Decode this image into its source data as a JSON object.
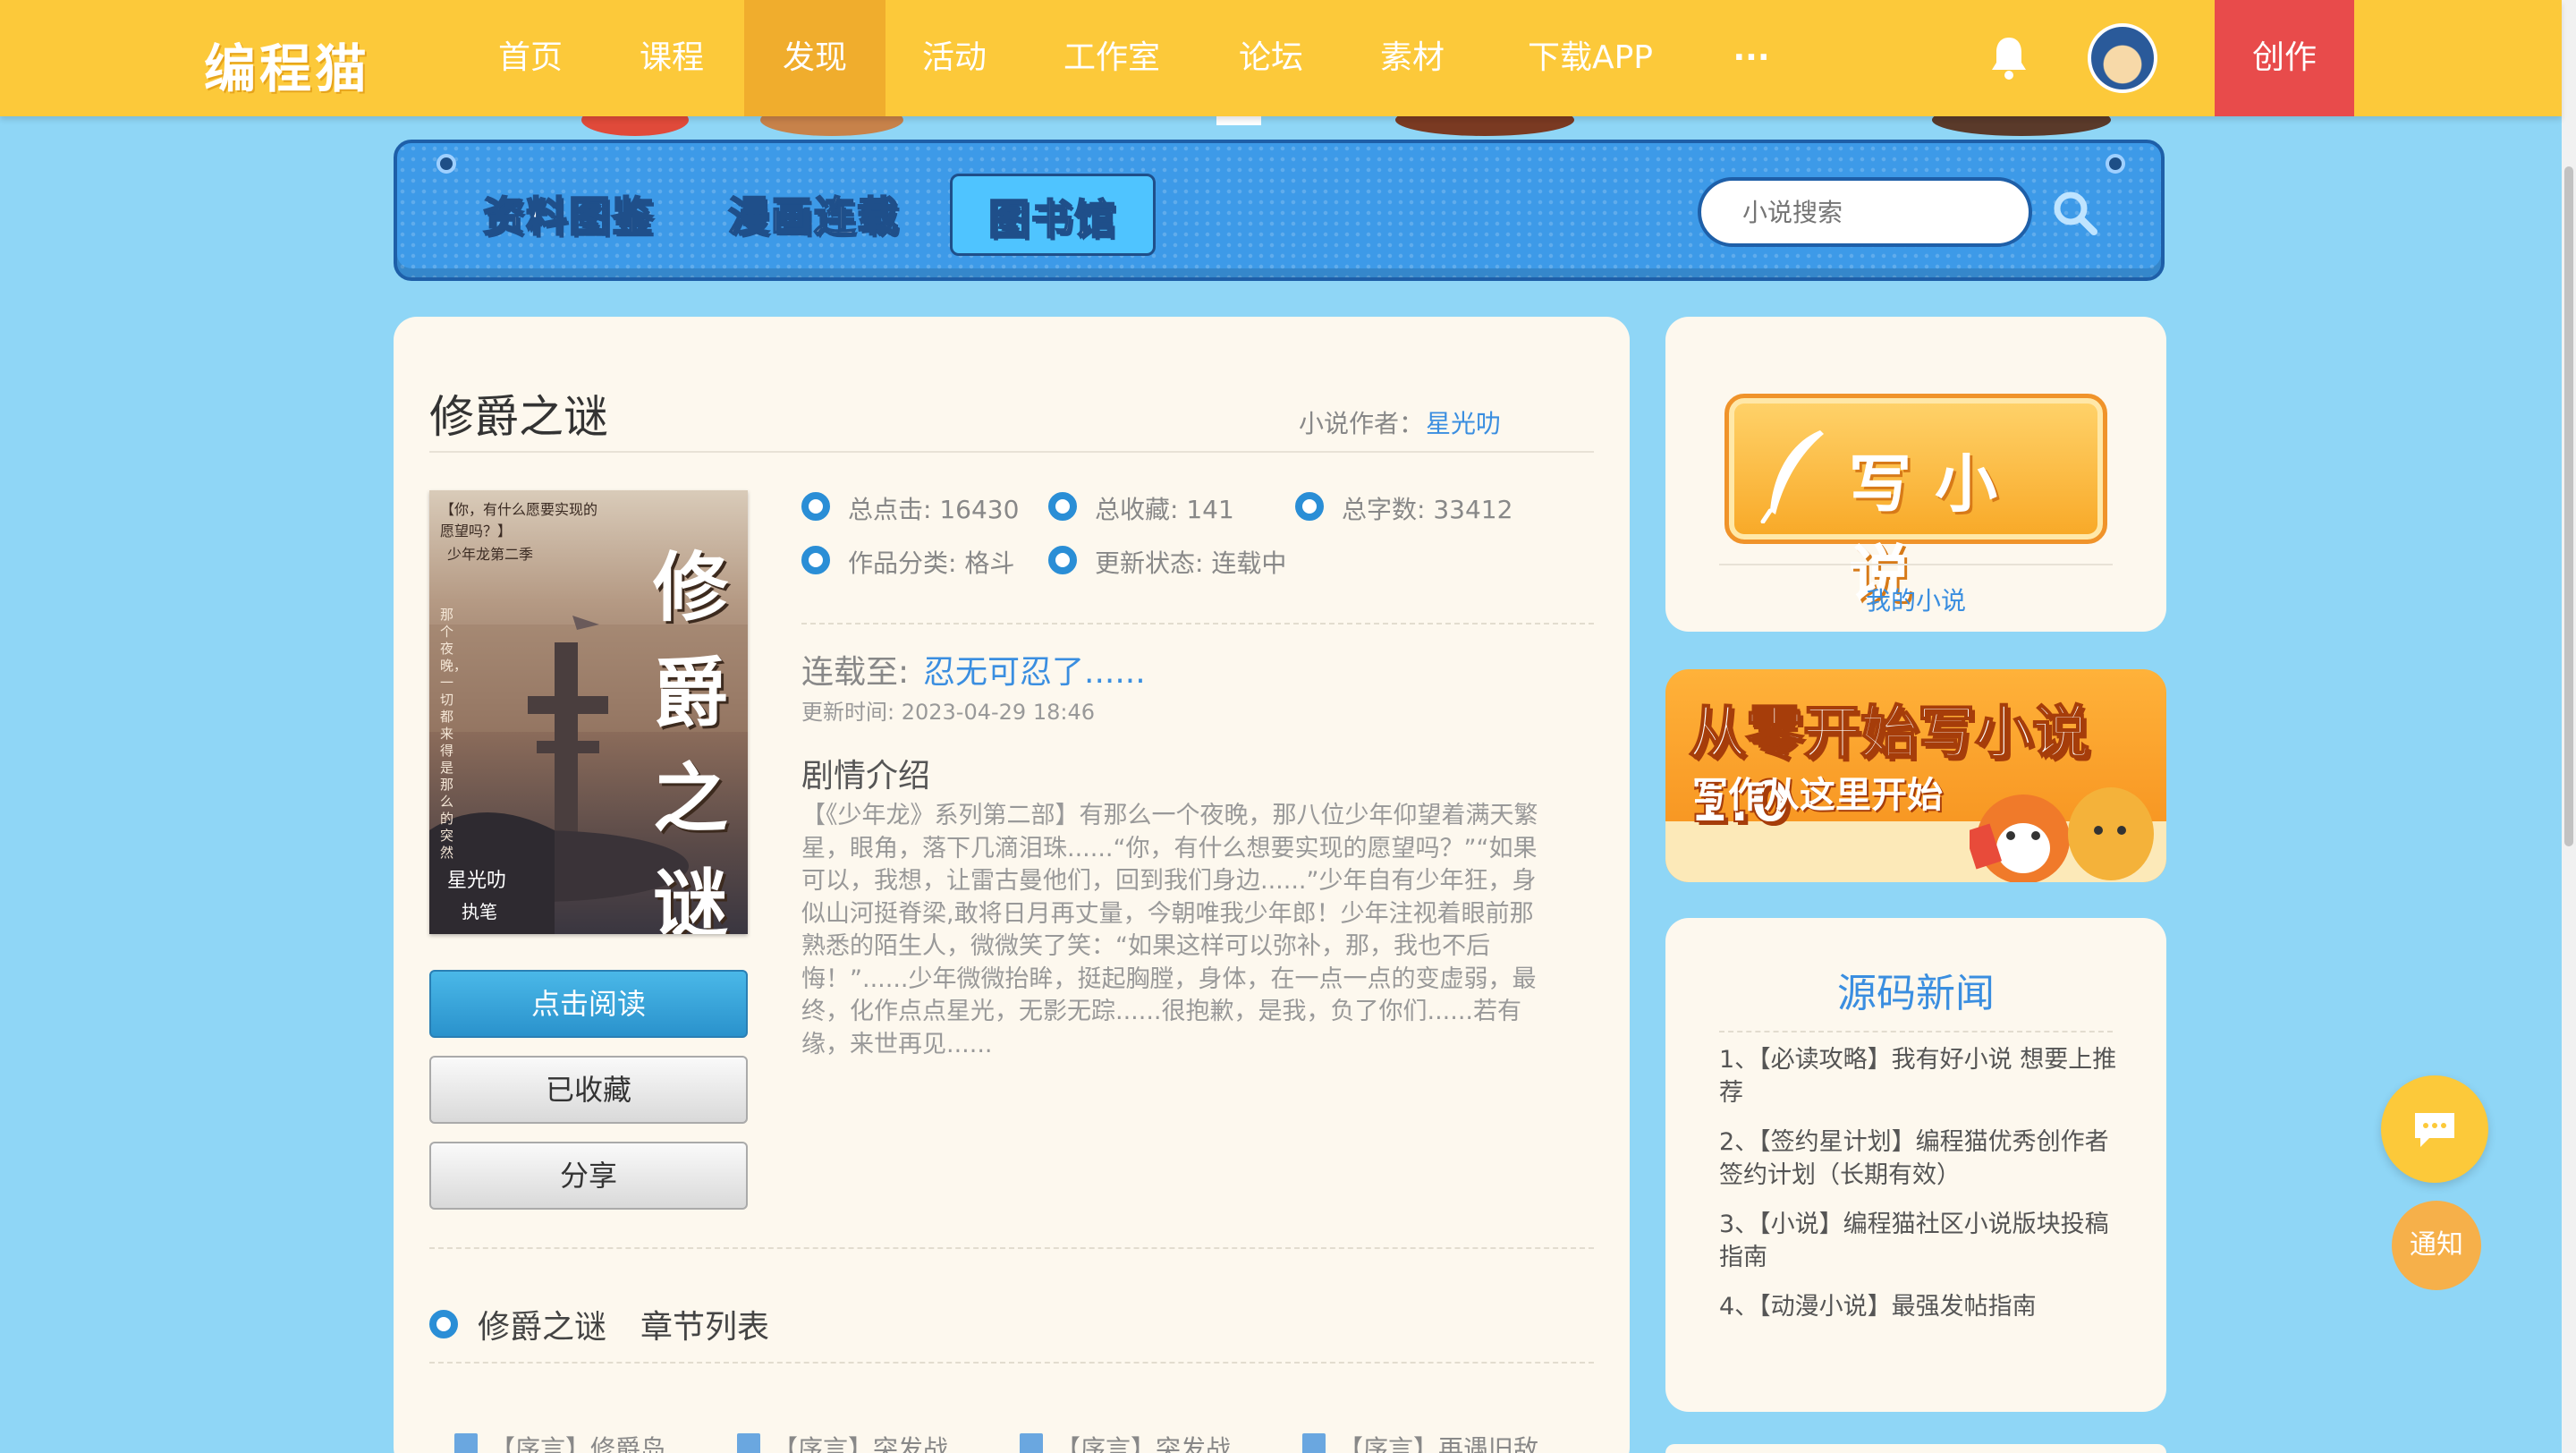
{
  "nav": {
    "logo": "编程猫",
    "items": [
      {
        "label": "首页"
      },
      {
        "label": "课程"
      },
      {
        "label": "发现"
      },
      {
        "label": "活动"
      },
      {
        "label": "工作室"
      },
      {
        "label": "论坛"
      },
      {
        "label": "素材"
      },
      {
        "label": "下载APP"
      },
      {
        "label": "···"
      }
    ],
    "active_item": "发现",
    "create_label": "创作"
  },
  "banner": {
    "tabs": [
      {
        "label": "资料图鉴"
      },
      {
        "label": "漫画连载"
      },
      {
        "label": "图书馆"
      }
    ],
    "active_tab": "图书馆",
    "search_placeholder": "小说搜索"
  },
  "book": {
    "title": "修爵之谜",
    "author_label": "小说作者：",
    "author_name": "星光叻",
    "cover": {
      "tagline": "【你，有什么愿要实现的愿望吗？】",
      "series": "少年龙第二季",
      "side_text": "那个夜晚，一切都来得是那么的突然",
      "title": "修爵之谜",
      "author": "星光叻",
      "author_suffix": "执笔"
    },
    "buttons": {
      "read": "点击阅读",
      "favorited": "已收藏",
      "share": "分享"
    },
    "stats": [
      {
        "label": "总点击: 16430"
      },
      {
        "label": "总收藏: 141"
      },
      {
        "label": "总字数: 33412"
      },
      {
        "label": "作品分类: 格斗"
      },
      {
        "label": "更新状态: 连载中"
      }
    ],
    "serial_label": "连载至:",
    "serial_chapter": "忍无可忍了......",
    "update_time": "更新时间: 2023-04-29 18:46",
    "synopsis_heading": "剧情介绍",
    "synopsis": "【《少年龙》系列第二部】有那么一个夜晚，那八位少年仰望着满天繁星，眼角，落下几滴泪珠......“你，有什么想要实现的愿望吗？”“如果可以，我想，让雷古曼他们，回到我们身边......”少年自有少年狂，身似山河挺脊梁,敢将日月再丈量，今朝唯我少年郎！少年注视着眼前那熟悉的陌生人，微微笑了笑：“如果这样可以弥补，那，我也不后悔！”......少年微微抬眸，挺起胸膛，身体，在一点一点的变虚弱，最终，化作点点星光，无影无踪......很抱歉，是我，负了你们......若有缘，来世再见......",
    "chapter_section_title": "修爵之谜",
    "chapter_list_label": "章节列表",
    "chapters": [
      {
        "label": "【序言】修爵岛"
      },
      {
        "label": "【序言】突发战"
      },
      {
        "label": "【序言】突发战"
      },
      {
        "label": "【序言】再遇旧敌"
      }
    ]
  },
  "sidebar": {
    "write_button": "写小说",
    "my_novels": "我的小说",
    "promo_title": "从零开始写小说1.0",
    "promo_subtitle": "写作从这里开始",
    "news_title": "源码新闻",
    "news": [
      {
        "text": "1、【必读攻略】我有好小说 想要上推荐"
      },
      {
        "text": "2、【签约星计划】编程猫优秀创作者签约计划（长期有效）"
      },
      {
        "text": "3、【小说】编程猫社区小说版块投稿指南"
      },
      {
        "text": "4、【动漫小说】最强发帖指南"
      }
    ]
  },
  "floating": {
    "chat_icon": "chat-bubble-icon",
    "notice_label": "通知"
  },
  "colors": {
    "nav_bg": "#fcc93a",
    "nav_active": "#f0ad2d",
    "create_bg": "#e84b4b",
    "page_bg": "#8fd6f6",
    "banner_bg": "#3d9ae8",
    "link": "#3a8ee0",
    "accent_blue": "#2a8ed6"
  }
}
